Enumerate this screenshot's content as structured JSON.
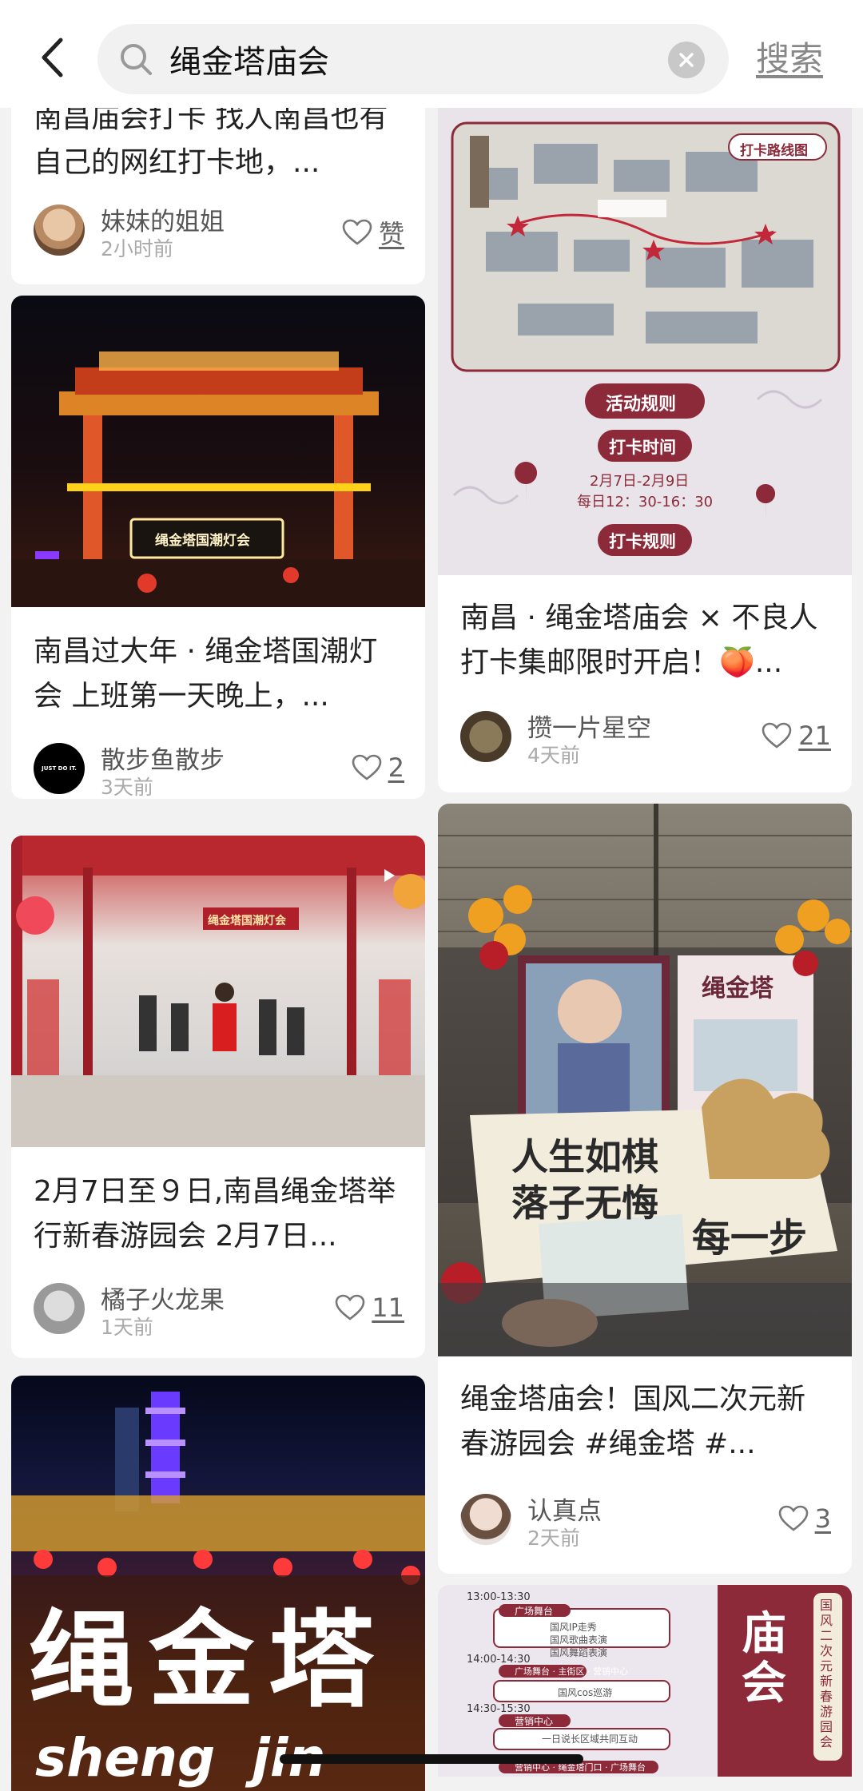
{
  "search": {
    "query": "绳金塔庙会",
    "submit_label": "搜索"
  },
  "cards": {
    "c1": {
      "title": "南昌庙会打卡 找人南昌也有自己的网红打卡地，...",
      "author": "妹妹的姐姐",
      "time": "2小时前",
      "likes": "赞"
    },
    "c2": {
      "title": "南昌过大年 · 绳金塔国潮灯会 上班第一天晚上，...",
      "author": "散步鱼散步",
      "time": "3天前",
      "likes": "2",
      "avatar_text": "JUST DO IT.",
      "sign_text": "绳金塔国潮灯会"
    },
    "c3": {
      "title": "2月7日至９日,南昌绳金塔举行新春游园会 2月7日...",
      "author": "橘子火龙果",
      "time": "1天前",
      "likes": "11",
      "sign_text": "绳金塔国潮灯会"
    },
    "c4": {
      "overlay_big": "绳金塔",
      "overlay_small": "sheng  jin"
    },
    "c5": {
      "map_badge": "打卡路线图",
      "rules_title": "活动规则",
      "time_label": "打卡时间",
      "date_line": "2月7日-2月9日",
      "hours_line": "每日12：30-16：30",
      "rules_label": "打卡规则",
      "title": "南昌 · 绳金塔庙会 × 不良人打卡集邮限时开启！🍑...",
      "author": "攒一片星空",
      "time": "4天前",
      "likes": "21"
    },
    "c6": {
      "board_line1": "人生如棋",
      "board_line2": "落子无悔",
      "board_line3": "每一步",
      "poster_title": "绳金塔",
      "title": "绳金塔庙会！国风二次元新春游园会 #绳金塔 #...",
      "author": "认真点",
      "time": "2天前",
      "likes": "3"
    },
    "c7": {
      "schedule": [
        {
          "time": "13:00-13:30",
          "place": "广场舞台",
          "acts": [
            "国风IP走秀",
            "国风歌曲表演",
            "国风舞蹈表演"
          ]
        },
        {
          "time": "14:00-14:30",
          "place": "广场舞台 · 主街区 · 营销中心",
          "acts": [
            "国风cos巡游"
          ]
        },
        {
          "time": "14:30-15:30",
          "place": "营销中心",
          "acts": [
            "一日说长区域共同互动"
          ]
        },
        {
          "time": "",
          "place": "营销中心 · 绳金塔门口 · 广场舞台",
          "acts": []
        }
      ],
      "side_big": "庙会",
      "side_vertical": "国风二次元新春游园会"
    }
  },
  "colors": {
    "accent_red": "#8c2a3a",
    "bg": "#f2f2f2",
    "card": "#ffffff"
  }
}
